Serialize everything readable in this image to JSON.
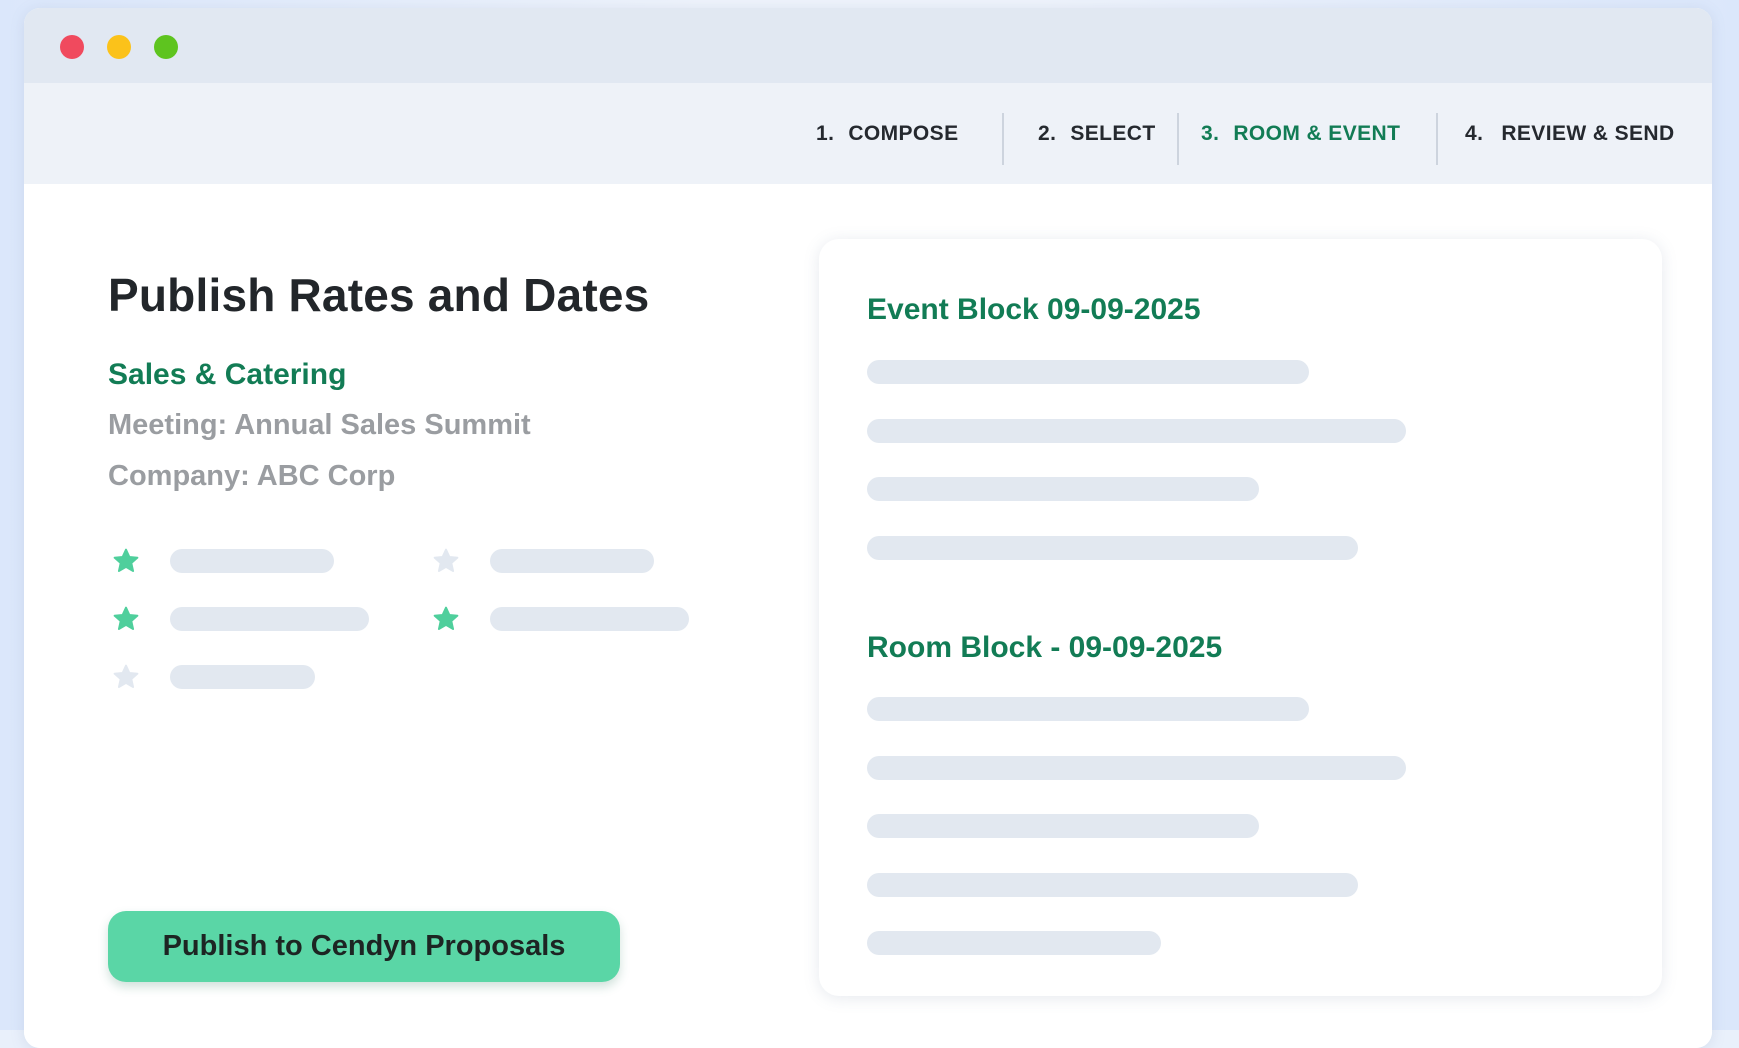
{
  "window": {
    "controls": [
      "close",
      "minimize",
      "maximize"
    ],
    "colors": {
      "close": "#f04a5e",
      "minimize": "#fbc21a",
      "maximize": "#5ec41f"
    }
  },
  "steps": [
    {
      "number": "1.",
      "label": "COMPOSE",
      "active": false
    },
    {
      "number": "2.",
      "label": "SELECT",
      "active": false
    },
    {
      "number": "3.",
      "label": "ROOM & EVENT",
      "active": true
    },
    {
      "number": "4.",
      "label": "REVIEW & SEND",
      "active": false
    }
  ],
  "left": {
    "title": "Publish Rates and Dates",
    "subtitle": "Sales & Catering",
    "meeting": "Meeting: Annual Sales Summit",
    "company": "Company: ABC Corp",
    "features": [
      {
        "icon": "star-icon",
        "state": "filled"
      },
      {
        "icon": "star-icon",
        "state": "empty"
      },
      {
        "icon": "star-icon",
        "state": "filled"
      },
      {
        "icon": "star-icon",
        "state": "filled"
      },
      {
        "icon": "star-icon",
        "state": "empty"
      }
    ],
    "publish_button": "Publish to Cendyn Proposals"
  },
  "card": {
    "event_heading": "Event Block 09-09-2025",
    "room_heading": "Room Block - 09-09-2025"
  },
  "colors": {
    "accent": "#127c55",
    "button": "#5ad6a6",
    "star_filled": "#4fcf9c",
    "star_empty": "#e2e8f0",
    "placeholder": "#e2e8f0"
  }
}
